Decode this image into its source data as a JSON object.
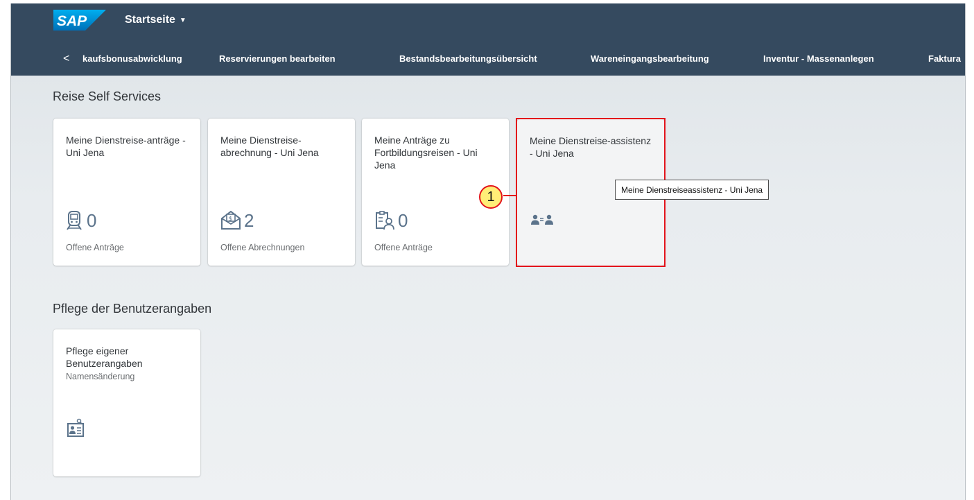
{
  "shell": {
    "logo_text": "SAP",
    "home_title": "Startseite",
    "home_caret": "▼"
  },
  "groupbar": {
    "back": "<",
    "items": [
      {
        "label": "kaufsbonusabwicklung"
      },
      {
        "label": "Reservierungen bearbeiten"
      },
      {
        "label": "Bestandsbearbeitungsübersicht"
      },
      {
        "label": "Wareneingangsbearbeitung"
      },
      {
        "label": "Inventur - Massenanlegen"
      },
      {
        "label": "Faktura"
      }
    ]
  },
  "sections": [
    {
      "title": "Reise Self Services",
      "tiles": [
        {
          "title": "Meine Dienstreise-anträge - Uni Jena",
          "kpi": "0",
          "footer": "Offene Anträge",
          "icon": "train-icon"
        },
        {
          "title": "Meine Dienstreise-abrechnung - Uni Jena",
          "kpi": "2",
          "footer": "Offene Abrechnungen",
          "icon": "expense-envelope-icon"
        },
        {
          "title": "Meine Anträge zu Fortbildungsreisen - Uni Jena",
          "kpi": "0",
          "footer": "Offene Anträge",
          "icon": "employee-list-icon"
        },
        {
          "title": "Meine Dienstreise-assistenz - Uni Jena",
          "icon": "group-delegation-icon"
        }
      ]
    },
    {
      "title": "Pflege der Benutzerangaben",
      "tiles": [
        {
          "title": "Pflege eigener Benutzerangaben",
          "subtitle": "Namensänderung",
          "icon": "contact-search-icon"
        }
      ]
    }
  ],
  "annotation": {
    "marker": "1",
    "tooltip": "Meine Dienstreiseassistenz - Uni Jena",
    "color": "#e3131b"
  },
  "colors": {
    "shell": "#354a5f",
    "icon": "#5b738b"
  }
}
